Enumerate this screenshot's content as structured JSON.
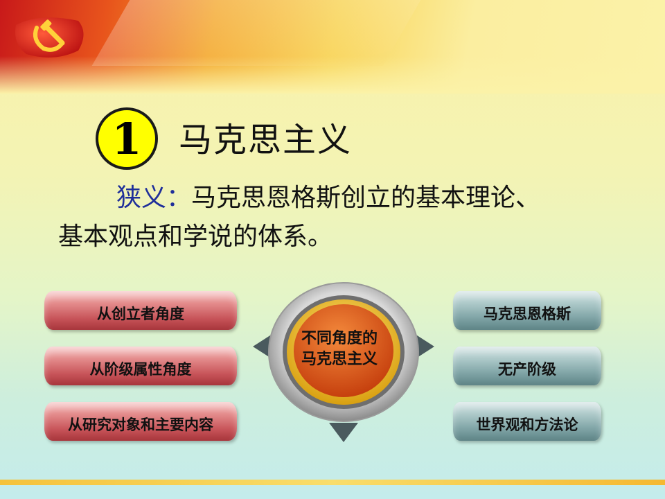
{
  "slide": {
    "number": "1",
    "title": "马克思主义",
    "narrow_keyword": "狭义：",
    "narrow_line1": "马克思恩格斯创立的基本理论、",
    "narrow_line2": "基本观点和学说的体系。"
  },
  "diagram": {
    "center_line1": "不同角度的",
    "center_line2": "马克思主义",
    "left_items": [
      "从创立者角度",
      "从阶级属性角度",
      "从研究对象和主要内容"
    ],
    "right_items": [
      "马克思恩格斯",
      "无产阶级",
      "世界观和方法论"
    ]
  },
  "colors": {
    "keyword": "#1f2f9a",
    "number_circle": "#ffff00",
    "hub_core": "#e15a1c",
    "left_pill": "#c8555a",
    "right_pill": "#7ea3a5"
  },
  "icons": [
    "party-emblem-icon",
    "arrow-left-icon",
    "arrow-right-icon",
    "arrow-down-icon"
  ]
}
